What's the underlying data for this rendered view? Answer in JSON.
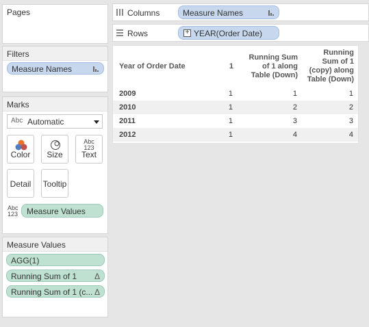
{
  "pages": {
    "title": "Pages"
  },
  "filters": {
    "title": "Filters",
    "pill": "Measure Names"
  },
  "marks": {
    "title": "Marks",
    "type_select": {
      "icon_text": "Abc",
      "value": "Automatic"
    },
    "buttons": [
      {
        "label": "Color"
      },
      {
        "label": "Size"
      },
      {
        "label": "Text",
        "icon_top": "Abc",
        "icon_bottom": "123"
      },
      {
        "label": "Detail"
      },
      {
        "label": "Tooltip"
      }
    ],
    "text_card": {
      "icon_top": "Abc",
      "icon_bottom": "123",
      "pill": "Measure Values"
    }
  },
  "measure_values": {
    "title": "Measure Values",
    "pills": [
      "AGG(1)",
      "Running Sum of 1",
      "Running Sum of 1 (c..."
    ]
  },
  "columns_shelf": {
    "label": "Columns",
    "pill": "Measure Names"
  },
  "rows_shelf": {
    "label": "Rows",
    "pill": "YEAR(Order Date)",
    "expand_glyph": "+"
  },
  "table": {
    "headers": [
      "Year of Order Date",
      "1",
      "Running Sum of 1 along Table (Down)",
      "Running Sum of 1 (copy) along Table (Down)"
    ],
    "rows": [
      [
        "2009",
        "1",
        "1",
        "1"
      ],
      [
        "2010",
        "1",
        "2",
        "2"
      ],
      [
        "2011",
        "1",
        "3",
        "3"
      ],
      [
        "2012",
        "1",
        "4",
        "4"
      ]
    ]
  },
  "colors": {
    "measure_pill": "#bfe1d2",
    "dimension_pill": "#c6d7ee",
    "band": "#f0f0f0",
    "background": "#e6e6e6"
  }
}
